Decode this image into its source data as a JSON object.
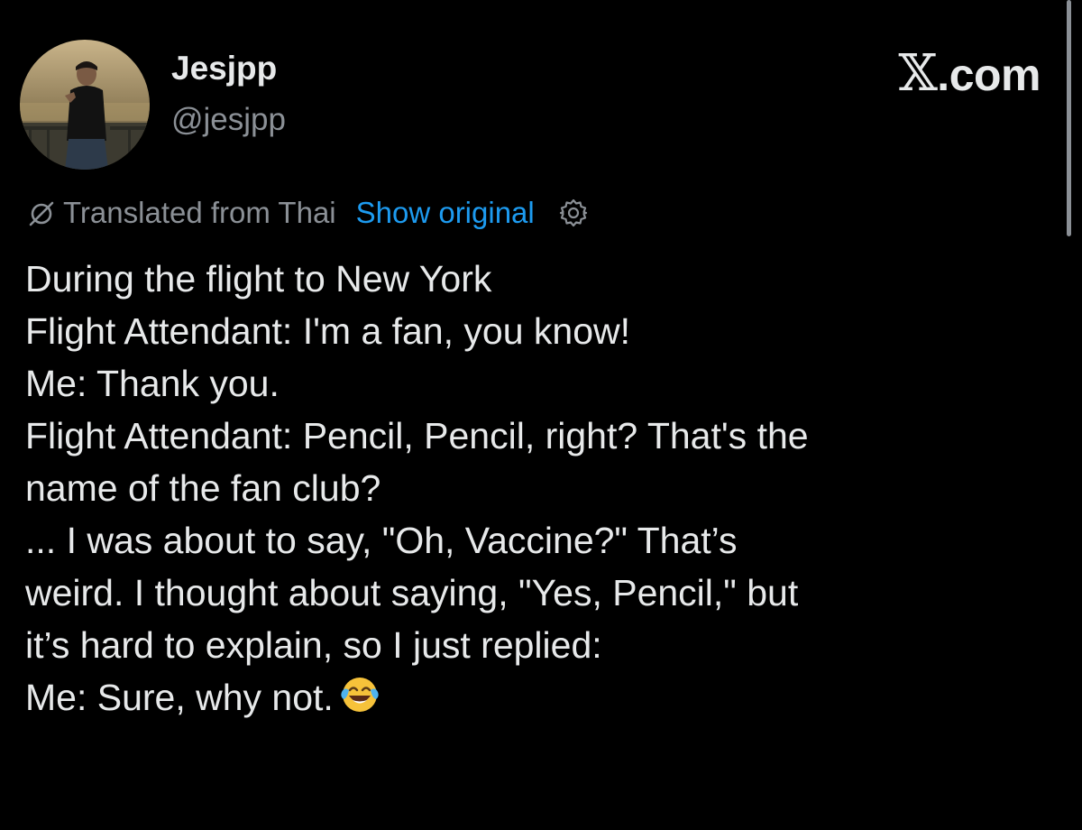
{
  "author": {
    "display_name": "Jesjpp",
    "handle": "@jesjpp",
    "avatar_icon": "profile-photo"
  },
  "brand": {
    "x_glyph": "𝕏",
    "domain": ".com"
  },
  "translation": {
    "icon": "translate-icon",
    "label": "Translated from Thai",
    "show_original": "Show original",
    "settings_icon": "gear-icon",
    "link_color": "#1d9bf0"
  },
  "tweet": {
    "lines": [
      "During the flight to New York",
      "Flight Attendant: I'm a fan, you know!",
      "Me: Thank you.",
      "Flight Attendant: Pencil, Pencil, right? That's the",
      "name of the fan club?",
      "... I was about to say, \"Oh, Vaccine?\" That’s",
      "weird. I thought about saying, \"Yes, Pencil,\" but",
      "it’s hard to explain, so I just replied:",
      "Me: Sure, why not."
    ],
    "trailing_emoji": "face-with-tears-of-joy"
  },
  "colors": {
    "background": "#000000",
    "primary_text": "#e7e9ea",
    "secondary_text": "#8b9096"
  }
}
